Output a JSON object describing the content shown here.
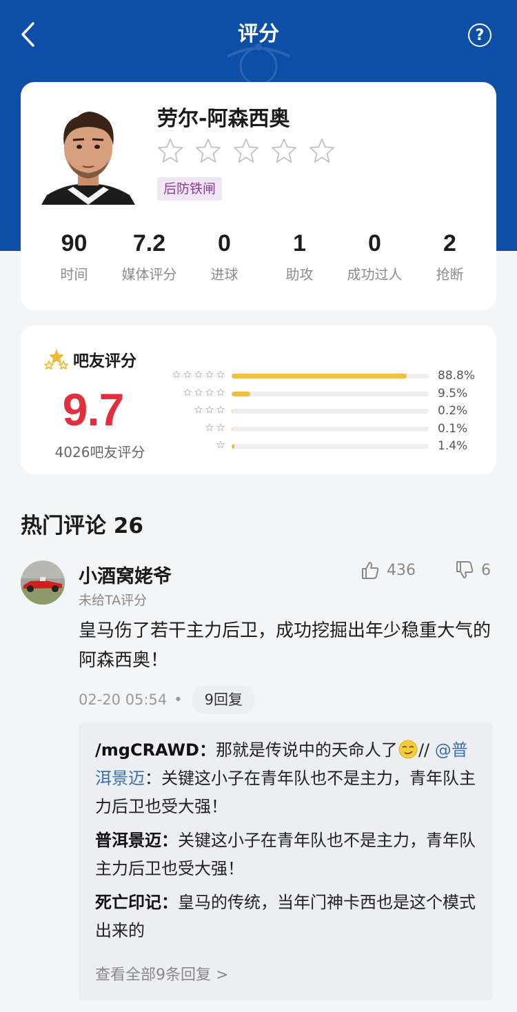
{
  "header": {
    "title": "评分",
    "help_glyph": "?",
    "bg_color": "#0d4ea6"
  },
  "player": {
    "name": "劳尔-阿森西奥",
    "star_count": 5,
    "tag": "后防铁闸",
    "stats": [
      {
        "value": "90",
        "label": "时间"
      },
      {
        "value": "7.2",
        "label": "媒体评分"
      },
      {
        "value": "0",
        "label": "进球"
      },
      {
        "value": "1",
        "label": "助攻"
      },
      {
        "value": "0",
        "label": "成功过人"
      },
      {
        "value": "2",
        "label": "抢断"
      }
    ]
  },
  "fan_rating": {
    "title": "吧友评分",
    "score": "9.7",
    "count_text": "4026吧友评分",
    "accent": "#e12f3e",
    "bar_color": "#f1bd42",
    "distribution": [
      {
        "stars": 5,
        "percent_text": "88.8%",
        "percent": 88.8
      },
      {
        "stars": 4,
        "percent_text": "9.5%",
        "percent": 9.5
      },
      {
        "stars": 3,
        "percent_text": "0.2%",
        "percent": 0.2
      },
      {
        "stars": 2,
        "percent_text": "0.1%",
        "percent": 0.1
      },
      {
        "stars": 1,
        "percent_text": "1.4%",
        "percent": 1.4
      }
    ]
  },
  "comments": {
    "section_title": "热门评论 26",
    "top": {
      "user": "小酒窝姥爷",
      "sub": "未给TA评分",
      "likes": "436",
      "dislikes": "6",
      "body": "皇马伤了若干主力后卫，成功挖掘出年少稳重大气的阿森西奥！",
      "time": "02-20 05:54",
      "dot": "•",
      "reply_count": "9回复",
      "replies": [
        {
          "author": "/mgCRAWD：",
          "text_before": "那就是传说中的天命人了",
          "text_mid": "// ",
          "mention": "@普洱景迈",
          "text_after": "：关键这小子在青年队也不是主力，青年队主力后卫也受大强！"
        },
        {
          "author": "普洱景迈：",
          "text": "关键这小子在青年队也不是主力，青年队主力后卫也受大强！"
        },
        {
          "author": "死亡印记：",
          "text": "皇马的传统，当年门神卡西也是这个模式出来的"
        }
      ],
      "view_all": "查看全部9条回复 >"
    }
  }
}
